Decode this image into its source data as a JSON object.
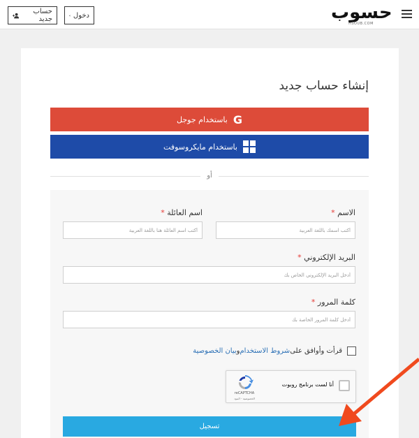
{
  "header": {
    "register_label": "حساب جديد",
    "login_label": "دخول",
    "logo_text": "حسوب",
    "logo_sub": "HSOUB.COM",
    "menu_icon": "hamburger-icon"
  },
  "main": {
    "title": "إنشاء حساب جديد",
    "google_label": "باستخدام جوجل",
    "microsoft_label": "باستخدام مايكروسوفت",
    "or_label": "أو",
    "first_name": {
      "label": "الاسم",
      "required": "*",
      "placeholder": "أكتب اسمك باللغة العربية"
    },
    "last_name": {
      "label": "اسم العائلة",
      "required": "*",
      "placeholder": "أكتب اسم العائلة هنا باللغة العربية"
    },
    "email": {
      "label": "البريد الإلكتروني",
      "required": "*",
      "placeholder": "أدخل البريد الإلكتروني الخاص بك"
    },
    "password": {
      "label": "كلمة المرور",
      "required": "*",
      "placeholder": "أدخل كلمة المرور الخاصة بك"
    },
    "terms": {
      "prefix": "قرأت وأوافق على ",
      "link1": "شروط الاستخدام",
      "middle": " و ",
      "link2": "بيان الخصوصية"
    },
    "recaptcha": {
      "label": "أنا لست برنامج روبوت",
      "brand": "reCAPTCHA",
      "terms": "الخصوصية - البنود"
    },
    "submit_label": "تسجيل"
  },
  "colors": {
    "google": "#dd4b39",
    "microsoft": "#1e4ba8",
    "submit": "#29a9e1",
    "link": "#2a6fb5",
    "required": "#e53935",
    "annotation_arrow": "#f04a1e"
  }
}
